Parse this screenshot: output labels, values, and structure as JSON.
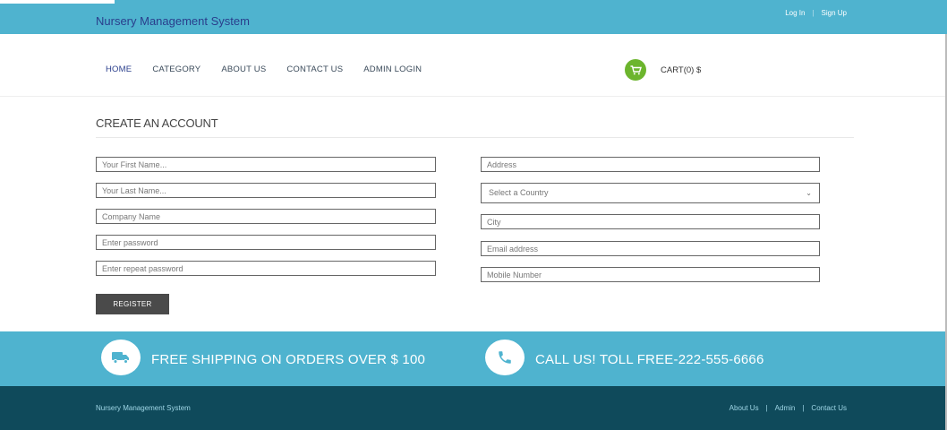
{
  "header": {
    "brand": "Nursery Management System",
    "login": "Log In",
    "signup": "Sign Up"
  },
  "nav": {
    "items": [
      "HOME",
      "CATEGORY",
      "ABOUT US",
      "CONTACT US",
      "ADMIN LOGIN"
    ],
    "cart_label": "CART(0) $",
    "cart_icon": "shopping-cart-icon"
  },
  "form": {
    "title": "CREATE AN ACCOUNT",
    "left": {
      "first_name": "Your First Name...",
      "last_name": "Your Last Name...",
      "company": "Company Name",
      "password": "Enter password",
      "repeat_password": "Enter repeat password"
    },
    "right": {
      "address": "Address",
      "country": "Select a Country",
      "city": "City",
      "email": "Email address",
      "mobile": "Mobile Number"
    },
    "register_label": "REGISTER"
  },
  "promo": {
    "shipping": "FREE SHIPPING ON ORDERS OVER $ 100",
    "call": "CALL US! TOLL FREE-222-555-6666",
    "shipping_icon": "truck-icon",
    "call_icon": "phone-icon"
  },
  "footer": {
    "brand": "Nursery Management System",
    "links": [
      "About Us",
      "Admin",
      "Contact Us"
    ]
  },
  "colors": {
    "accent": "#4fb3cf",
    "footer": "#0f4a5b",
    "cart": "#6cb52d",
    "button": "#4a4a4a"
  }
}
